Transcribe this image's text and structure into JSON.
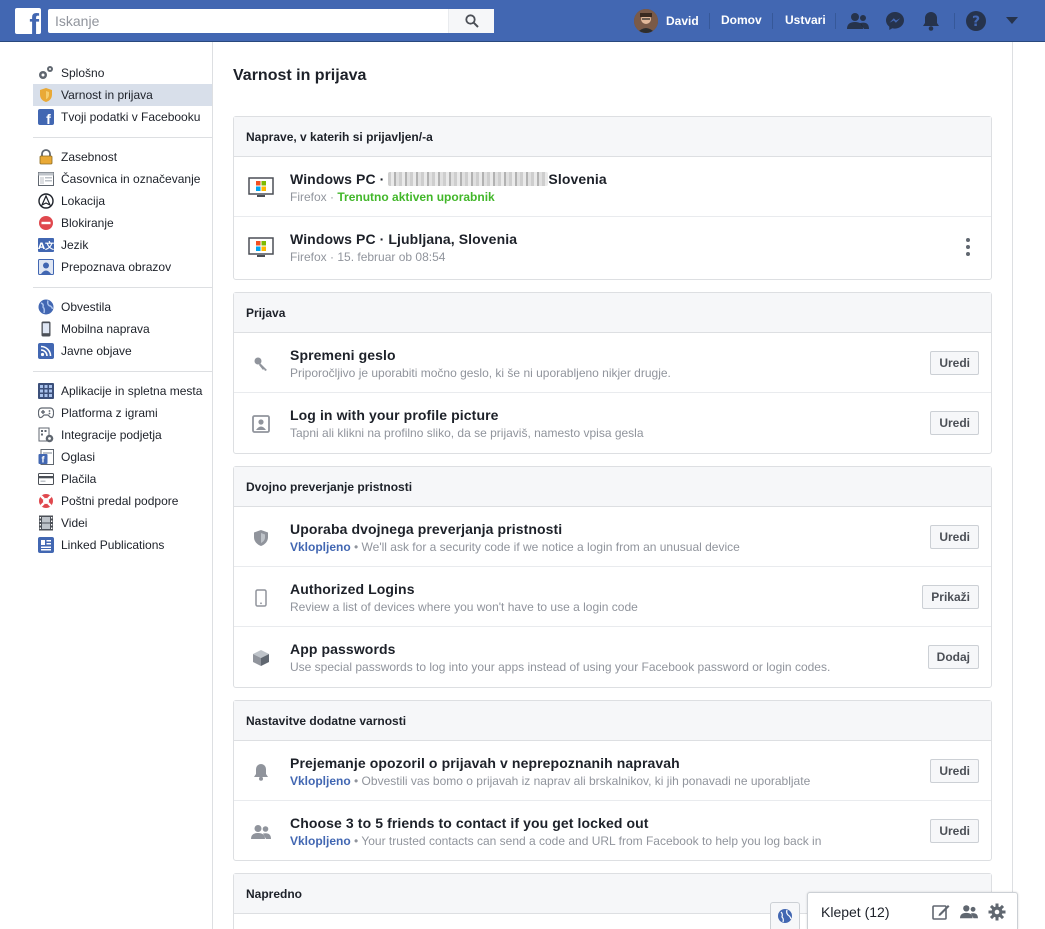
{
  "topbar": {
    "search_placeholder": "Iskanje",
    "user_name": "David",
    "home_label": "Domov",
    "create_label": "Ustvari"
  },
  "sidebar": {
    "groups": [
      [
        {
          "label": "Splošno",
          "icon": "gears-icon"
        },
        {
          "label": "Varnost in prijava",
          "icon": "shield-badge-icon",
          "active": true
        },
        {
          "label": "Tvoji podatki v Facebooku",
          "icon": "facebook-icon"
        }
      ],
      [
        {
          "label": "Zasebnost",
          "icon": "lock-icon"
        },
        {
          "label": "Časovnica in označevanje",
          "icon": "timeline-icon"
        },
        {
          "label": "Lokacija",
          "icon": "location-icon"
        },
        {
          "label": "Blokiranje",
          "icon": "block-icon"
        },
        {
          "label": "Jezik",
          "icon": "language-icon"
        },
        {
          "label": "Prepoznava obrazov",
          "icon": "face-icon"
        }
      ],
      [
        {
          "label": "Obvestila",
          "icon": "globe-icon"
        },
        {
          "label": "Mobilna naprava",
          "icon": "mobile-icon"
        },
        {
          "label": "Javne objave",
          "icon": "rss-icon"
        }
      ],
      [
        {
          "label": "Aplikacije in spletna mesta",
          "icon": "apps-icon"
        },
        {
          "label": "Platforma z igrami",
          "icon": "gamepad-icon"
        },
        {
          "label": "Integracije podjetja",
          "icon": "business-icon"
        },
        {
          "label": "Oglasi",
          "icon": "ads-icon"
        },
        {
          "label": "Plačila",
          "icon": "card-icon"
        },
        {
          "label": "Poštni predal podpore",
          "icon": "lifebuoy-icon"
        },
        {
          "label": "Videi",
          "icon": "film-icon"
        },
        {
          "label": "Linked Publications",
          "icon": "publication-icon"
        }
      ]
    ]
  },
  "main": {
    "title": "Varnost in prijava",
    "sections": {
      "devices": {
        "title": "Naprave, v katerih si prijavljen/-a",
        "rows": [
          {
            "title_prefix": "Windows PC · ",
            "title_suffix": "Slovenia",
            "browser": "Firefox",
            "status": "Trenutno aktiven uporabnik"
          },
          {
            "title": "Windows PC · Ljubljana, Slovenia",
            "browser": "Firefox",
            "time": "15. februar ob 08:54"
          }
        ]
      },
      "login": {
        "title": "Prijava",
        "rows": [
          {
            "title": "Spremeni geslo",
            "desc": "Priporočljivo je uporabiti močno geslo, ki še ni uporabljeno nikjer drugje.",
            "button": "Uredi",
            "icon": "key-icon"
          },
          {
            "title": "Log in with your profile picture",
            "desc": "Tapni ali klikni na profilno sliko, da se prijaviš, namesto vpisa gesla",
            "button": "Uredi",
            "icon": "profile-picture-icon"
          }
        ]
      },
      "twofactor": {
        "title": "Dvojno preverjanje pristnosti",
        "rows": [
          {
            "title": "Uporaba dvojnega preverjanja pristnosti",
            "status": "Vklopljeno",
            "desc": " • We'll ask for a security code if we notice a login from an unusual device",
            "button": "Uredi",
            "icon": "shield-icon"
          },
          {
            "title": "Authorized Logins",
            "desc": "Review a list of devices where you won't have to use a login code",
            "button": "Prikaži",
            "icon": "phone-icon"
          },
          {
            "title": "App passwords",
            "desc": "Use special passwords to log into your apps instead of using your Facebook password or login codes.",
            "button": "Dodaj",
            "icon": "cube-icon"
          }
        ]
      },
      "extra": {
        "title": "Nastavitve dodatne varnosti",
        "rows": [
          {
            "title": "Prejemanje opozoril o prijavah v neprepoznanih napravah",
            "status": "Vklopljeno",
            "desc": " • Obvestili vas bomo o prijavah iz naprav ali brskalnikov, ki jih ponavadi ne uporabljate",
            "button": "Uredi",
            "icon": "bell-icon"
          },
          {
            "title": "Choose 3 to 5 friends to contact if you get locked out",
            "status": "Vklopljeno",
            "desc": " • Your trusted contacts can send a code and URL from Facebook to help you log back in",
            "button": "Uredi",
            "icon": "friends-icon"
          }
        ]
      },
      "advanced": {
        "title": "Napredno"
      }
    }
  },
  "chat": {
    "label": "Klepet (12)"
  }
}
